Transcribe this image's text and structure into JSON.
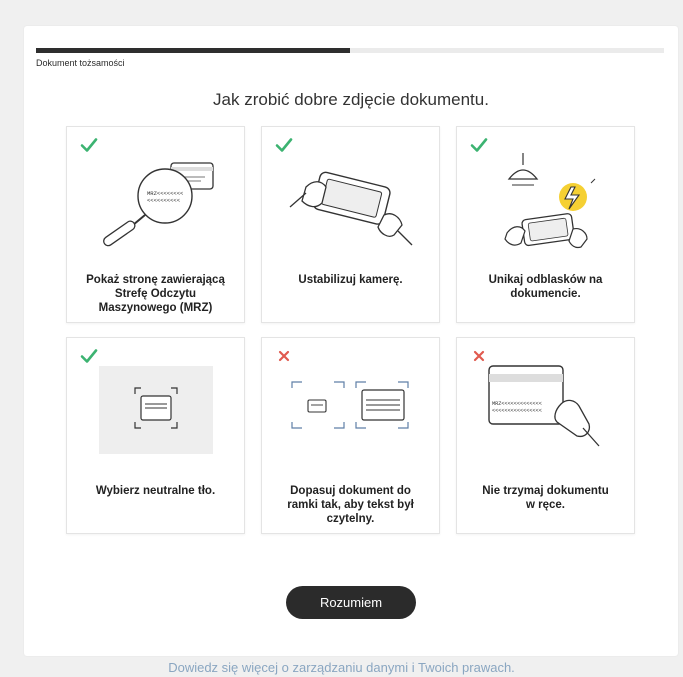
{
  "step": {
    "label": "Dokument tożsamości",
    "progress_fraction": 0.5
  },
  "heading": "Jak zrobić dobre zdjęcie dokumentu.",
  "tiles": [
    {
      "status": "ok",
      "caption_lines": [
        "Pokaż stronę zawierającą",
        "Strefę Odczytu",
        "Maszynowego (MRZ)"
      ],
      "mrz_text_1": "MRZ<<<<<<<<",
      "mrz_text_2": "<<<<<<<<<<"
    },
    {
      "status": "ok",
      "caption_lines": [
        "Ustabilizuj kamerę."
      ]
    },
    {
      "status": "ok",
      "caption_lines": [
        "Unikaj odblasków na",
        "dokumencie."
      ]
    },
    {
      "status": "ok",
      "caption_lines": [
        "Wybierz neutralne tło."
      ]
    },
    {
      "status": "bad",
      "caption_lines": [
        "Dopasuj dokument do",
        "ramki tak, aby tekst był",
        "czytelny."
      ]
    },
    {
      "status": "bad",
      "caption_lines": [
        "Nie trzymaj dokumentu",
        "w ręce."
      ],
      "mrz_text_1": "MRZ<<<<<<<<<<<<<",
      "mrz_text_2": "<<<<<<<<<<<<<<<<"
    }
  ],
  "button": {
    "label": "Rozumiem"
  },
  "footer": {
    "link_text": "Dowiedz się więcej o zarządzaniu danymi i Twoich prawach."
  },
  "colors": {
    "ok": "#3cb371",
    "bad": "#e05a4f",
    "accent_yellow": "#f5d033",
    "button_bg": "#2b2b2b",
    "link": "#8aa6c1"
  },
  "icons": {
    "ok": "checkmark-icon",
    "bad": "cross-icon"
  }
}
